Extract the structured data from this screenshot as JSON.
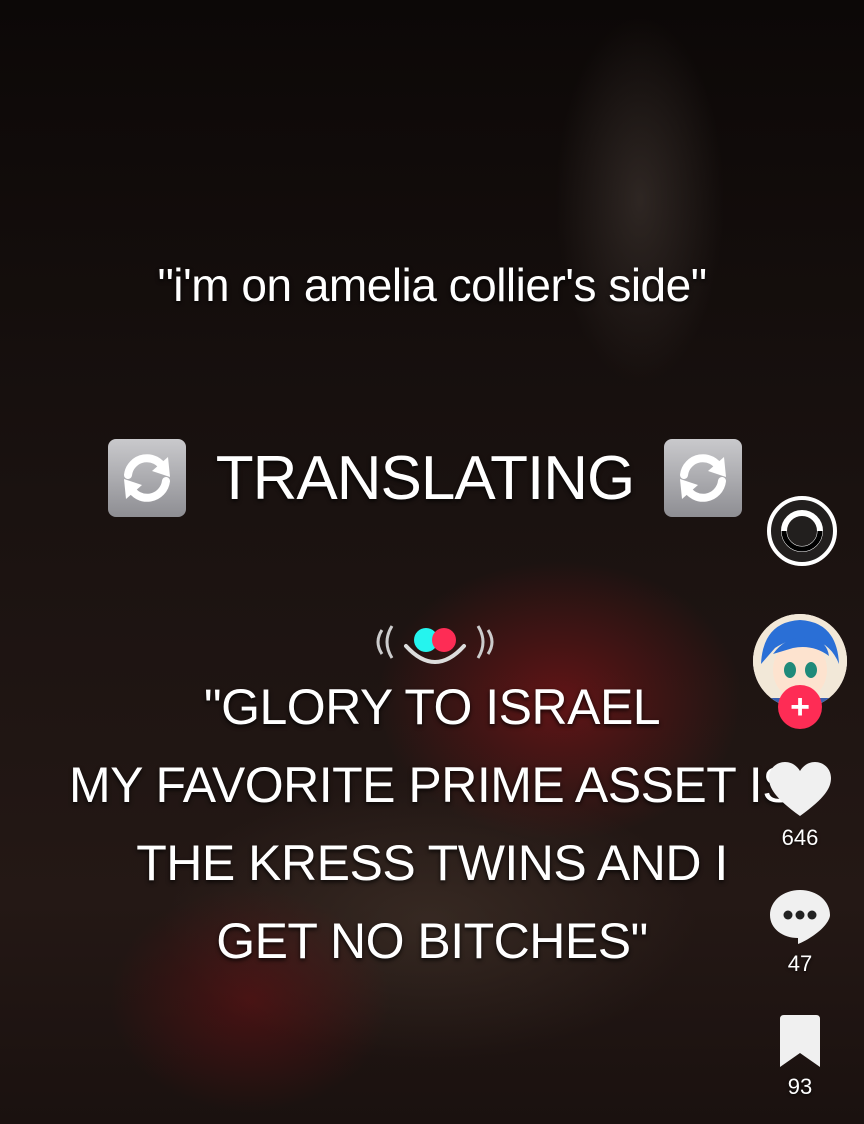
{
  "captions": {
    "top": "\"i'm on amelia collier's side\"",
    "translating": "TRANSLATING",
    "bottom_lines": [
      "\"GLORY TO ISRAEL",
      "MY FAVORITE PRIME ASSET IS",
      "THE KRESS TWINS AND I",
      "GET NO BITCHES\""
    ]
  },
  "icons": {
    "translating_emoji": "arrows-counterclockwise-icon",
    "ring": "ring-icon",
    "audio": "audio-waves-icon",
    "follow": "plus-icon",
    "like": "heart-icon",
    "comment": "comment-icon",
    "bookmark": "bookmark-icon"
  },
  "actions": {
    "follow_symbol": "+",
    "like_count": "646",
    "comment_count": "47",
    "bookmark_count": "93"
  },
  "colors": {
    "accent_pink": "#fe2c55",
    "accent_cyan": "#25f4ee",
    "text": "#ffffff"
  }
}
